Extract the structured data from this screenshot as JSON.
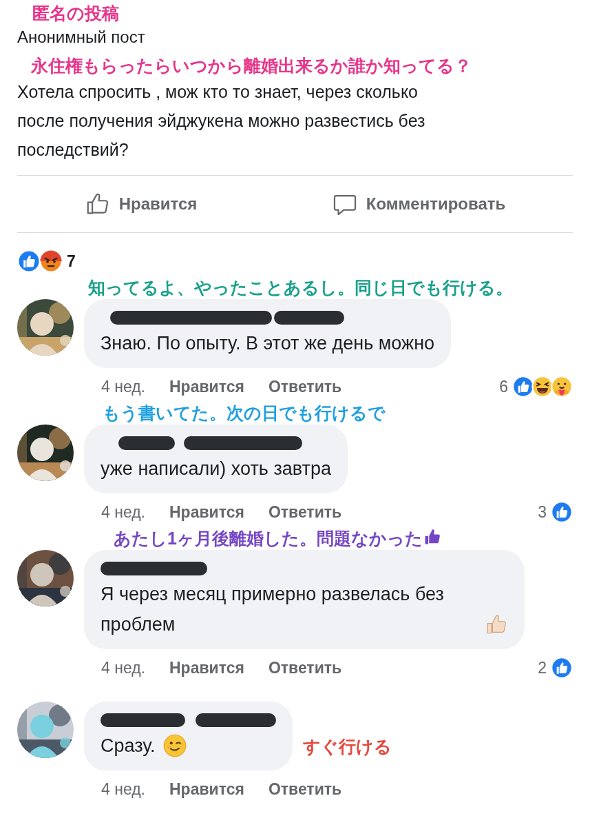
{
  "post": {
    "annotation_title": {
      "text": "匿名の投稿",
      "color": "#e8338a"
    },
    "author": "Анонимный пост",
    "annotation": {
      "text": "永住権もらったらいつから離婚出来るか誰か知ってる？",
      "color": "#e8338a"
    },
    "text": "Хотела спросить , мож кто то знает, через сколько после получения эйджукена можно развестись без последствий?"
  },
  "actions": [
    {
      "kind": "like",
      "label": "Нравится"
    },
    {
      "kind": "comment",
      "label": "Комментировать"
    }
  ],
  "reactions": {
    "kinds": [
      {
        "kind": "like"
      },
      {
        "kind": "angry"
      }
    ],
    "count": "7"
  },
  "comments": [
    {
      "annotation": {
        "text": "知ってるよ、やったことあるし。同じ日でも行ける。",
        "color": "#17a08a",
        "kind": "above"
      },
      "text": "Знаю. По опыту. В этот же день можно",
      "time": "4 нед.",
      "like": "Нравится",
      "reply": "Ответить",
      "reaction_count": "6",
      "reactions": [
        {
          "kind": "like"
        },
        {
          "kind": "haha"
        },
        {
          "kind": "care"
        }
      ]
    },
    {
      "annotation": {
        "text": "もう書いてた。次の日でも行けるで",
        "color": "#1e9fe0",
        "kind": "above"
      },
      "text": "уже написали) хоть завтра",
      "time": "4 нед.",
      "like": "Нравится",
      "reply": "Ответить",
      "reaction_count": "3",
      "reactions": [
        {
          "kind": "like"
        }
      ]
    },
    {
      "annotation": {
        "text": "あたし1ヶ月後離婚した。問題なかった",
        "color": "#7546c4",
        "kind": "above",
        "emoji": {
          "kind": "thumbs-up"
        }
      },
      "text": "Я через месяц примерно развелась без проблем",
      "emoji": {
        "kind": "thumbs-up"
      },
      "time": "4 нед.",
      "like": "Нравится",
      "reply": "Ответить",
      "reaction_count": "2",
      "reactions": [
        {
          "kind": "like"
        }
      ]
    },
    {
      "annotation": {
        "text": "すぐ行ける",
        "color": "#e6463c",
        "kind": "right"
      },
      "text": "Сразу.",
      "emoji": {
        "kind": "wink"
      },
      "time": "4 нед.",
      "like": "Нравится",
      "reply": "Ответить"
    }
  ]
}
